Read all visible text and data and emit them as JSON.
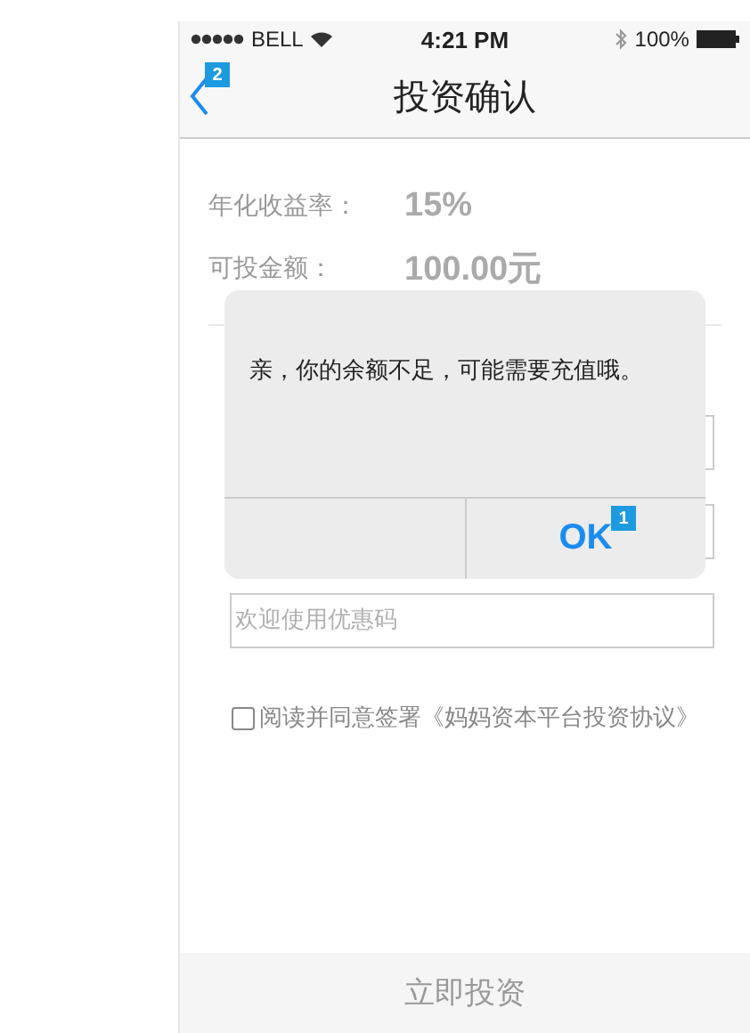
{
  "status_bar": {
    "carrier": "BELL",
    "time": "4:21 PM",
    "battery": "100%"
  },
  "nav": {
    "title": "投资确认",
    "back_badge": "2"
  },
  "summary": [
    {
      "label": "年化收益率：",
      "value": "15%"
    },
    {
      "label": "可投金额：",
      "value": "100.00元"
    }
  ],
  "fields": [
    {
      "kind": "input"
    },
    {
      "kind": "input"
    },
    {
      "kind": "input",
      "placeholder": "欢迎使用优惠码"
    }
  ],
  "agreement": {
    "text": "阅读并同意签署《妈妈资本平台投资协议》",
    "checked": false
  },
  "submit": "立即投资",
  "dialog": {
    "message": "亲，你的余额不足，可能需要充值哦。",
    "buttons": [
      {
        "kind": "plain"
      },
      {
        "label": "OK",
        "kind": "primary",
        "badge": "1"
      }
    ]
  }
}
